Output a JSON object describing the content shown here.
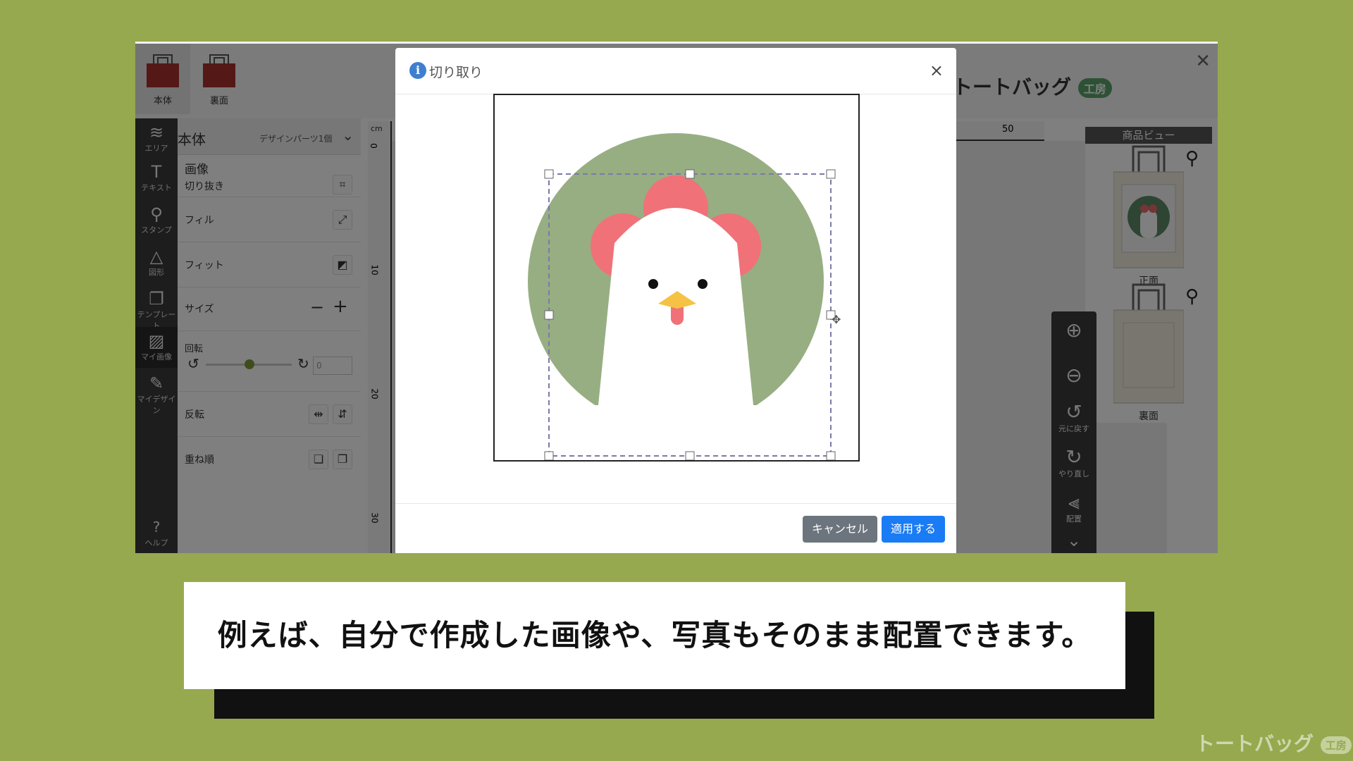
{
  "app": {
    "tabs": [
      {
        "label": "本体"
      },
      {
        "label": "裏面"
      }
    ],
    "brand": {
      "text": "トートバッグ",
      "badge": "工房"
    },
    "iconbar": [
      {
        "label": "エリア",
        "icon": "layers-icon"
      },
      {
        "label": "テキスト",
        "icon": "text-icon"
      },
      {
        "label": "スタンプ",
        "icon": "stamp-icon"
      },
      {
        "label": "図形",
        "icon": "shapes-icon"
      },
      {
        "label": "テンプレート",
        "icon": "template-icon"
      },
      {
        "label": "マイ画像",
        "icon": "image-icon"
      },
      {
        "label": "マイデザイン",
        "icon": "design-icon"
      },
      {
        "label": "ヘルプ",
        "icon": "help-icon"
      }
    ],
    "panel": {
      "title": "本体",
      "parts": "デザインパーツ1個",
      "section": "画像",
      "crop": "切り抜き",
      "fill": "フィル",
      "fit": "フィット",
      "size": "サイズ",
      "rotate": "回転",
      "rotate_value": "0",
      "flip": "反転",
      "order": "重ね順"
    },
    "ruler": {
      "unit": "cm",
      "v_ticks": [
        "0",
        "10",
        "20",
        "30"
      ],
      "h_tick": "50"
    },
    "zoom": {
      "undo": "元に戻す",
      "redo": "やり直し",
      "align": "配置"
    },
    "preview": {
      "title": "商品ビュー",
      "front": "正面",
      "back": "裏面"
    }
  },
  "modal": {
    "title": "切り取り",
    "close": "×",
    "cancel": "キャンセル",
    "apply": "適用する",
    "image_colors": {
      "circle": "#97ae82",
      "comb": "#f07178",
      "beak": "#f6c244",
      "body": "#ffffff"
    }
  },
  "caption": "例えば、自分で作成した画像や、写真もそのまま配置できます。",
  "watermark": {
    "text": "トートバッグ",
    "badge": "工房"
  }
}
